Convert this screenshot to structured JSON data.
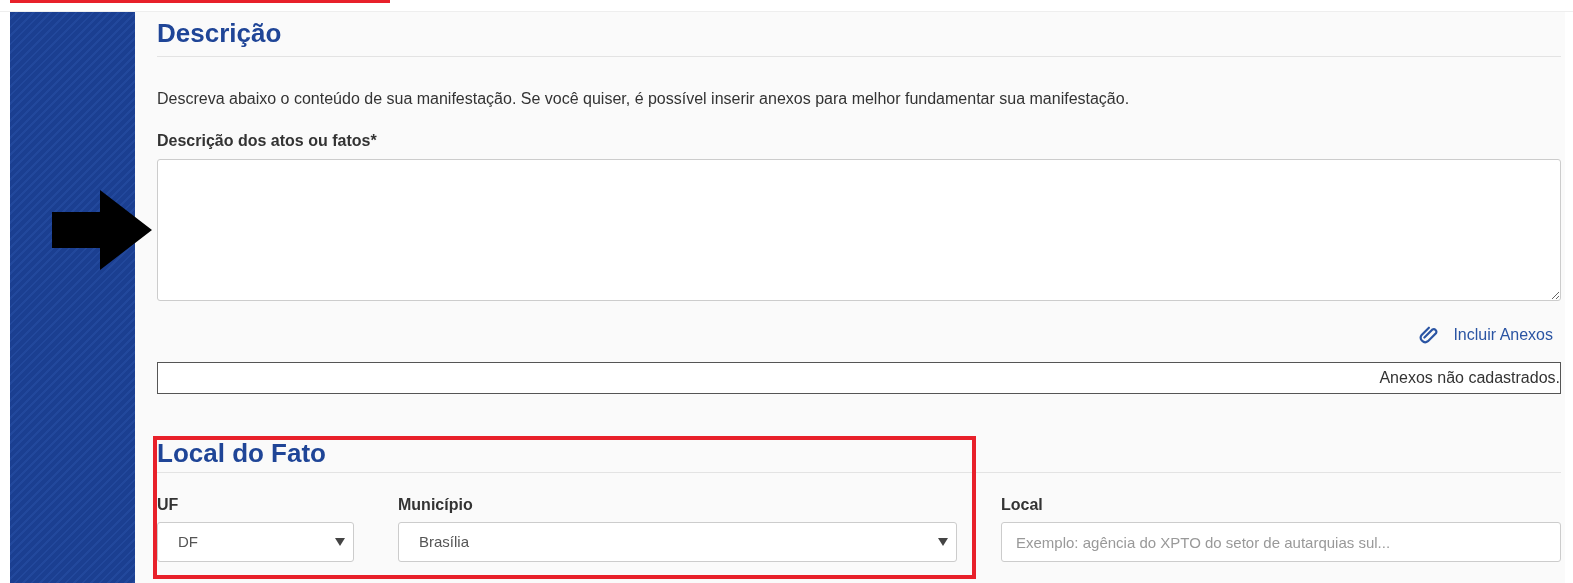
{
  "description_section": {
    "title": "Descrição",
    "intro": "Descreva abaixo o conteúdo de sua manifestação. Se você quiser, é possível inserir anexos para melhor fundamentar sua manifestação.",
    "field_label": "Descrição dos atos ou fatos*",
    "attach_link": "Incluir Anexos",
    "attachments_status": "Anexos não cadastrados."
  },
  "local_section": {
    "title": "Local do Fato",
    "fields": [
      {
        "kind": "select",
        "label": "UF",
        "value": "DF"
      },
      {
        "kind": "select",
        "label": "Município",
        "value": "Brasília"
      },
      {
        "kind": "text",
        "label": "Local",
        "placeholder": "Exemplo: agência do XPTO do setor de autarquias sul..."
      }
    ]
  }
}
